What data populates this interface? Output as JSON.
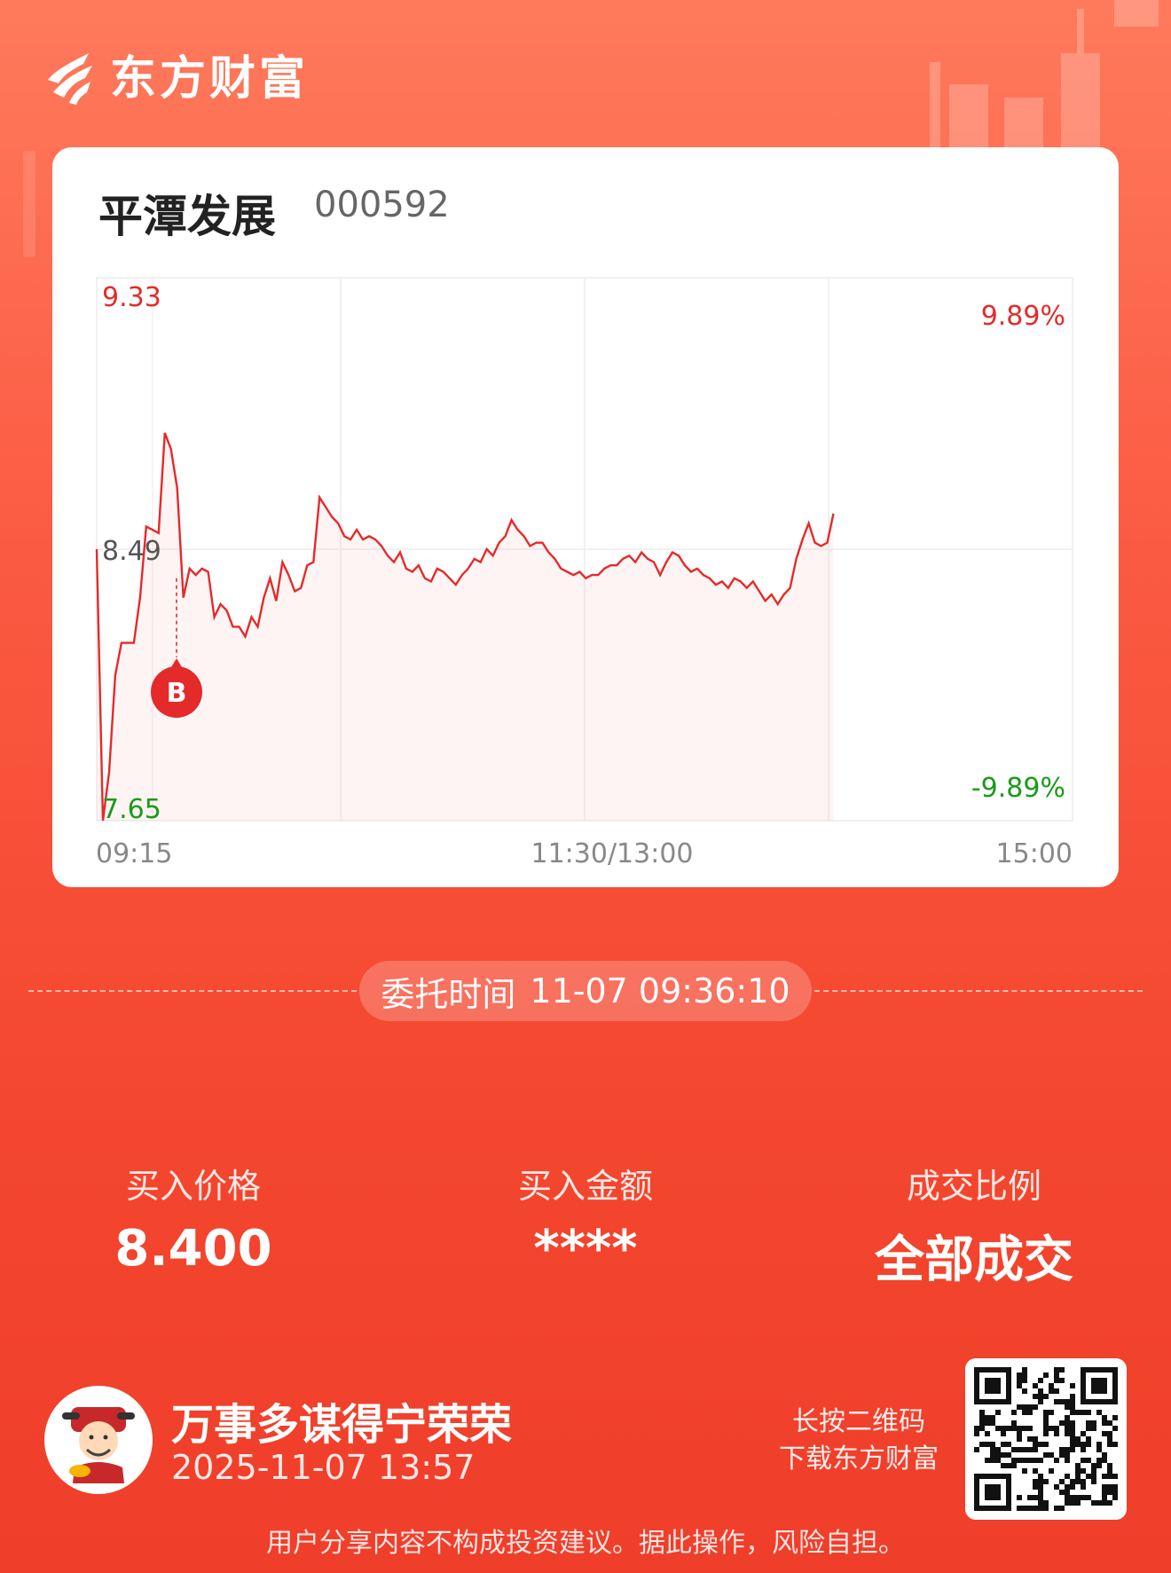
{
  "brand": {
    "name": "东方财富"
  },
  "stock": {
    "name": "平潭发展",
    "code": "000592"
  },
  "chart": {
    "price_high": "9.33",
    "price_mid": "8.49",
    "price_low": "7.65",
    "pct_high": "9.89%",
    "pct_low": "-9.89%",
    "time_start": "09:15",
    "time_mid": "11:30/13:00",
    "time_end": "15:00",
    "marker_label": "B",
    "colors": {
      "line": "#e52a2a",
      "up": "#e52a2a",
      "down": "#1a9b1a"
    }
  },
  "chart_data": {
    "type": "line",
    "ylim": [
      7.65,
      9.33
    ],
    "y_pct": [
      "9.89%",
      "-9.89%"
    ],
    "x_ticks": [
      "09:15",
      "11:30/13:00",
      "15:00"
    ],
    "prev_close": 8.49,
    "series": [
      {
        "values": [
          8.49,
          7.65,
          7.8,
          8.1,
          8.2,
          8.2,
          8.2,
          8.34,
          8.56,
          8.55,
          8.54,
          8.85,
          8.8,
          8.68,
          8.34,
          8.43,
          8.41,
          8.43,
          8.42,
          8.28,
          8.32,
          8.3,
          8.25,
          8.25,
          8.22,
          8.28,
          8.25,
          8.34,
          8.4,
          8.33,
          8.45,
          8.41,
          8.36,
          8.37,
          8.44,
          8.45,
          8.65,
          8.62,
          8.59,
          8.57,
          8.53,
          8.52,
          8.55,
          8.52,
          8.53,
          8.52,
          8.5,
          8.47,
          8.45,
          8.48,
          8.43,
          8.42,
          8.44,
          8.4,
          8.39,
          8.43,
          8.42,
          8.4,
          8.38,
          8.41,
          8.43,
          8.46,
          8.45,
          8.49,
          8.47,
          8.51,
          8.53,
          8.58,
          8.55,
          8.53,
          8.5,
          8.51,
          8.51,
          8.48,
          8.46,
          8.43,
          8.42,
          8.41,
          8.42,
          8.4,
          8.41,
          8.41,
          8.43,
          8.44,
          8.44,
          8.46,
          8.47,
          8.45,
          8.48,
          8.46,
          8.45,
          8.41,
          8.45,
          8.48,
          8.47,
          8.44,
          8.42,
          8.43,
          8.41,
          8.4,
          8.38,
          8.39,
          8.37,
          8.4,
          8.39,
          8.37,
          8.39,
          8.36,
          8.33,
          8.35,
          8.32,
          8.35,
          8.37,
          8.46,
          8.52,
          8.57,
          8.51,
          8.5,
          8.51,
          8.6
        ]
      }
    ],
    "marker": {
      "label": "B",
      "price": 8.4,
      "time": "09:36"
    }
  },
  "order": {
    "label": "委托时间",
    "time": "11-07 09:36:10"
  },
  "stats": [
    {
      "label": "买入价格",
      "value": "8.400"
    },
    {
      "label": "买入金额",
      "value": "****"
    },
    {
      "label": "成交比例",
      "value": "全部成交"
    }
  ],
  "user": {
    "name": "万事多谋得宁荣荣",
    "time": "2025-11-07 13:57"
  },
  "download": {
    "line1": "长按二维码",
    "line2": "下载东方财富"
  },
  "disclaimer": "用户分享内容不构成投资建议。据此操作，风险自担。"
}
